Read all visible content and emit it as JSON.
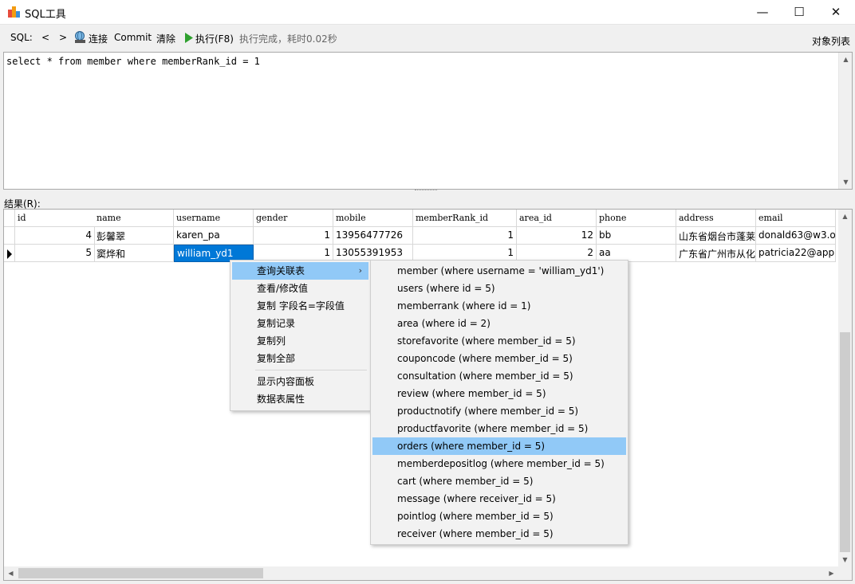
{
  "window": {
    "title": "SQL工具",
    "controls": {
      "minimize": "—",
      "maximize": "☐",
      "close": "✕"
    }
  },
  "toolbar": {
    "sql_label": "SQL:",
    "prev": "<",
    "next": ">",
    "connect": "连接",
    "commit": "Commit",
    "clear": "清除",
    "execute": "执行(F8)",
    "status": "执行完成，耗时0.02秒",
    "object_list": "对象列表"
  },
  "editor": {
    "sql": "select * from member where memberRank_id = 1"
  },
  "results": {
    "label": "结果(R):",
    "columns": [
      "id",
      "name",
      "username",
      "gender",
      "mobile",
      "memberRank_id",
      "area_id",
      "phone",
      "address",
      "email"
    ],
    "rows": [
      [
        "4",
        "彭馨翠",
        "karen_pa",
        "1",
        "13956477726",
        "1",
        "12",
        "bb",
        "山东省烟台市蓬莱",
        "donald63@w3.o"
      ],
      [
        "5",
        "窦烨和",
        "william_yd1",
        "1",
        "13055391953",
        "1",
        "2",
        "aa",
        "广东省广州市从化",
        "patricia22@appl"
      ]
    ]
  },
  "context_menu": {
    "items": [
      "查询关联表",
      "查看/修改值",
      "复制 字段名=字段值",
      "复制记录",
      "复制列",
      "复制全部",
      "显示内容面板",
      "数据表属性"
    ],
    "submenu_arrow": "›"
  },
  "submenu": {
    "items": [
      "member (where username = 'william_yd1')",
      "users (where id = 5)",
      "memberrank (where id = 1)",
      "area (where id = 2)",
      "storefavorite (where member_id = 5)",
      "couponcode (where member_id = 5)",
      "consultation (where member_id = 5)",
      "review (where member_id = 5)",
      "productnotify (where member_id = 5)",
      "productfavorite (where member_id = 5)",
      "orders (where member_id = 5)",
      "memberdepositlog (where member_id = 5)",
      "cart (where member_id = 5)",
      "message (where receiver_id = 5)",
      "pointlog (where member_id = 5)",
      "receiver (where member_id = 5)"
    ]
  },
  "colors": {
    "selection": "#0078d7",
    "menu_highlight": "#91c9f7",
    "execute_icon": "#2ea02e"
  },
  "icons": [
    "app-icon",
    "connect-icon",
    "execute-icon",
    "row-marker-icon",
    "chevron-right-icon"
  ]
}
